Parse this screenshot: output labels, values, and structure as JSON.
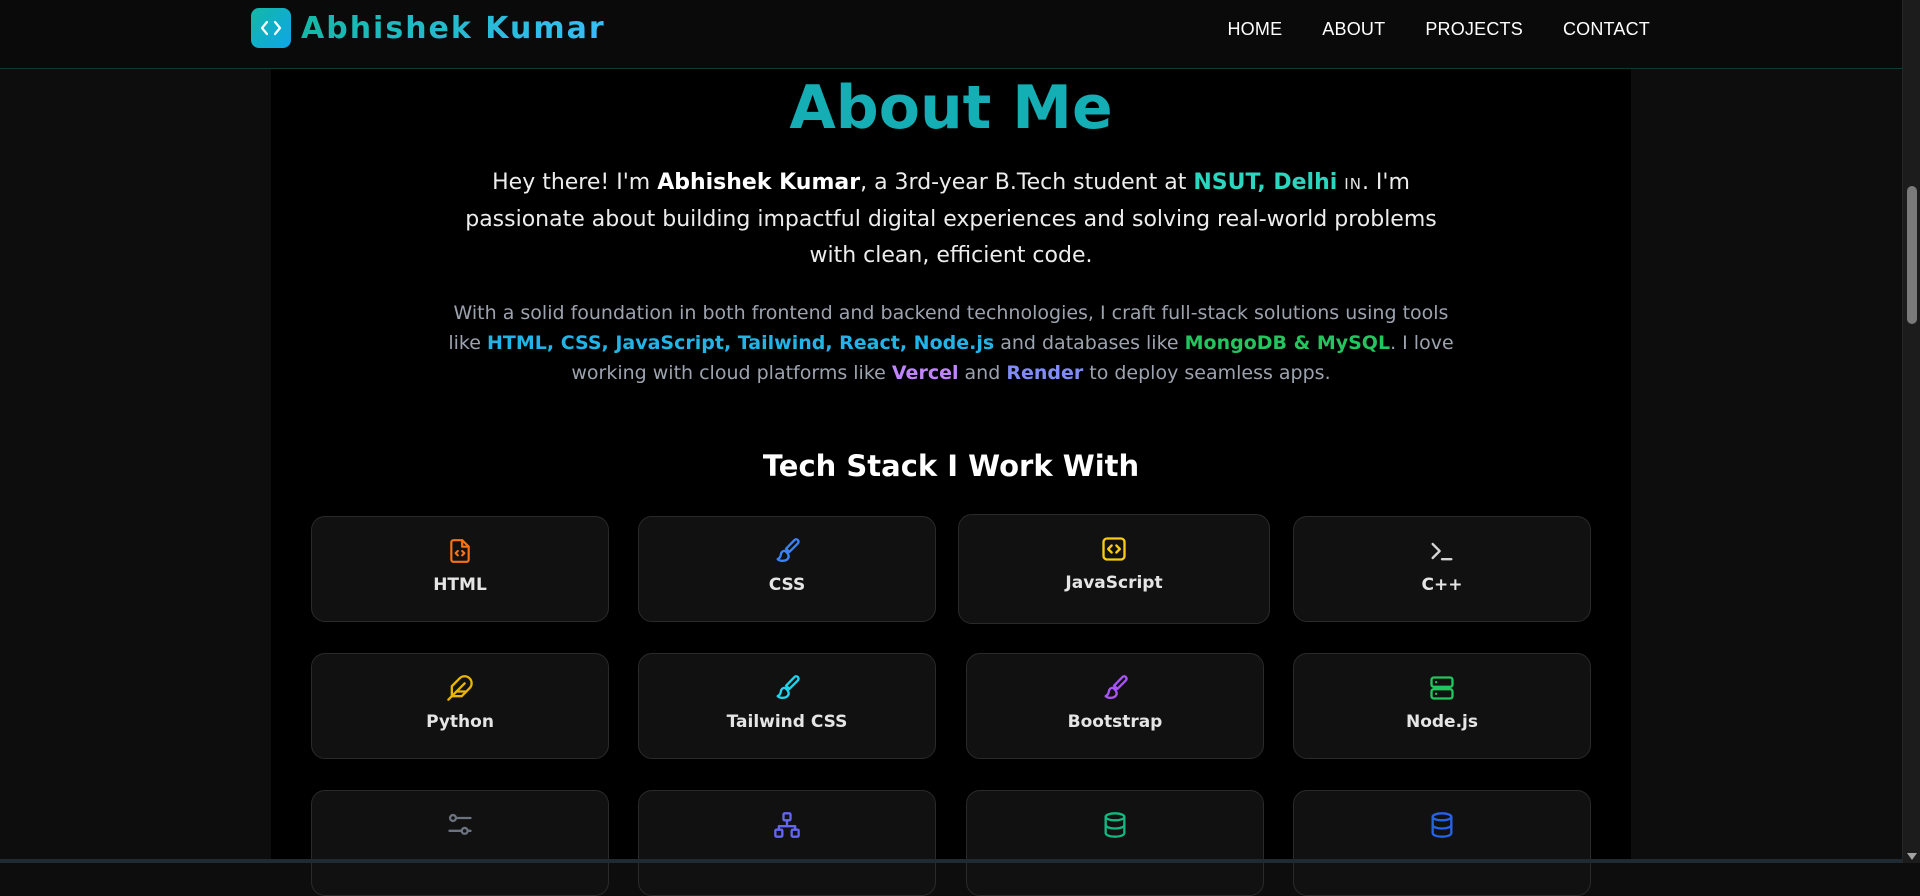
{
  "brand": {
    "name": "Abhishek Kumar",
    "logo_icon": "code-brackets-icon"
  },
  "nav": {
    "links": [
      {
        "label": "HOME"
      },
      {
        "label": "ABOUT"
      },
      {
        "label": "PROJECTS"
      },
      {
        "label": "CONTACT"
      }
    ]
  },
  "about": {
    "title": "About Me",
    "intro": {
      "greeting": "Hey there! I'm ",
      "name": "Abhishek Kumar",
      "middle": ", a 3rd-year B.Tech student at ",
      "college": "NSUT, Delhi",
      "flag": "IN",
      "rest": ". I'm passionate about building impactful digital experiences and solving real-world problems with clean, efficient code."
    },
    "bio": {
      "p1": "With a solid foundation in both frontend and backend technologies, I craft full-stack solutions using tools like ",
      "tools": "HTML, CSS, JavaScript, Tailwind, React, Node.js",
      "p2": " and databases like ",
      "databases": "MongoDB & MySQL",
      "p3": ". I love working with cloud platforms like ",
      "cloud1": "Vercel",
      "p4": " and ",
      "cloud2": "Render",
      "p5": " to deploy seamless apps."
    }
  },
  "tech_stack": {
    "title": "Tech Stack I Work With",
    "items": [
      {
        "label": "HTML",
        "icon": "file-code-icon",
        "color": "#f97316"
      },
      {
        "label": "CSS",
        "icon": "paintbrush-icon",
        "color": "#3b82f6"
      },
      {
        "label": "JavaScript",
        "icon": "code-square-icon",
        "color": "#facc15"
      },
      {
        "label": "C++",
        "icon": "terminal-icon",
        "color": "#d4d4d4"
      },
      {
        "label": "Python",
        "icon": "feather-icon",
        "color": "#eab308"
      },
      {
        "label": "Tailwind CSS",
        "icon": "paintbrush-icon",
        "color": "#22d3ee"
      },
      {
        "label": "Bootstrap",
        "icon": "paintbrush-icon",
        "color": "#a855f7"
      },
      {
        "label": "Node.js",
        "icon": "server-icon",
        "color": "#22c55e"
      },
      {
        "label": "",
        "icon": "sliders-icon",
        "color": "#6b7280"
      },
      {
        "label": "",
        "icon": "network-icon",
        "color": "#6366f1"
      },
      {
        "label": "",
        "icon": "database-icon",
        "color": "#10b981"
      },
      {
        "label": "",
        "icon": "database-icon",
        "color": "#2563eb"
      }
    ]
  },
  "colors": {
    "accent": "#14aeb4",
    "background": "#000000",
    "card_background": "#111111"
  }
}
